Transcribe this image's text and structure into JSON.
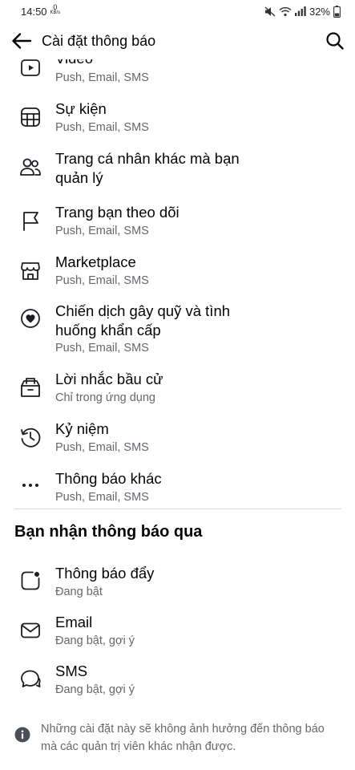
{
  "status_bar": {
    "time": "14:50",
    "net_speed_value": "0",
    "net_speed_unit": "KB/s",
    "battery": "32%"
  },
  "header": {
    "title": "Cài đặt thông báo"
  },
  "notification_types": [
    {
      "title": "Video",
      "subtitle": "Push, Email, SMS",
      "icon": "video-icon"
    },
    {
      "title": "Sự kiện",
      "subtitle": "Push, Email, SMS",
      "icon": "calendar-icon"
    },
    {
      "title": "Trang cá nhân khác mà bạn",
      "title_line2": "quản lý",
      "subtitle": "",
      "icon": "people-icon"
    },
    {
      "title": "Trang bạn theo dõi",
      "subtitle": "Push, Email, SMS",
      "icon": "flag-icon"
    },
    {
      "title": "Marketplace",
      "subtitle": "Push, Email, SMS",
      "icon": "shop-icon"
    },
    {
      "title": "Chiến dịch gây quỹ và tình",
      "title_line2": "huống khẩn cấp",
      "subtitle": "Push, Email, SMS",
      "icon": "heart-circle-icon"
    },
    {
      "title": "Lời nhắc bầu cử",
      "subtitle": "Chỉ trong ứng dụng",
      "icon": "ballot-box-icon"
    },
    {
      "title": "Kỷ niệm",
      "subtitle": "Push, Email, SMS",
      "icon": "history-icon"
    },
    {
      "title": "Thông báo khác",
      "subtitle": "Push, Email, SMS",
      "icon": "more-icon"
    }
  ],
  "delivery_section": {
    "title": "Bạn nhận thông báo qua",
    "items": [
      {
        "title": "Thông báo đẩy",
        "subtitle": "Đang bật",
        "icon": "push-notification-icon"
      },
      {
        "title": "Email",
        "subtitle": "Đang bật, gợi ý",
        "icon": "envelope-icon"
      },
      {
        "title": "SMS",
        "subtitle": "Đang bật, gợi ý",
        "icon": "chat-bubble-icon"
      }
    ]
  },
  "footer_note": {
    "line1": "Những cài đặt này sẽ không ảnh hưởng đến thông báo",
    "line2": "mà các quản trị viên khác nhận được."
  }
}
